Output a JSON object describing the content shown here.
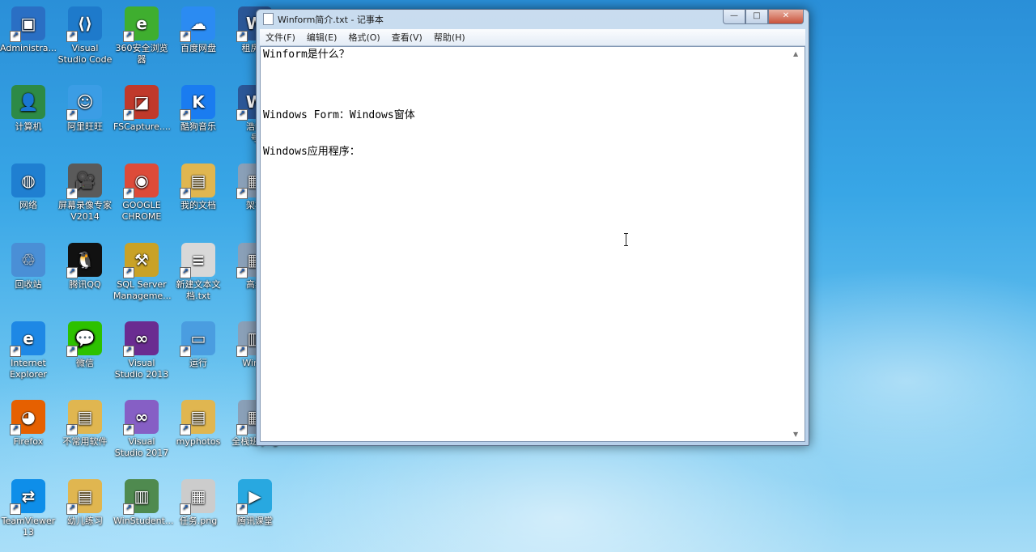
{
  "desktop_icons": [
    {
      "label": "Administra...",
      "glyph": "▣",
      "color": "#2a6fc4"
    },
    {
      "label": "Visual Studio Code",
      "glyph": "⟨⟩",
      "color": "#1e7acb"
    },
    {
      "label": "360安全浏览器",
      "glyph": "e",
      "color": "#3fae2f"
    },
    {
      "label": "百度网盘",
      "glyph": "☁",
      "color": "#2b8bf2"
    },
    {
      "label": "租房合",
      "glyph": "W",
      "color": "#2b5797"
    },
    {
      "label": "计算机",
      "glyph": "👤",
      "color": "#2d8a46"
    },
    {
      "label": "阿里旺旺",
      "glyph": "☺",
      "color": "#3b9de5"
    },
    {
      "label": "FSCapture....",
      "glyph": "◪",
      "color": "#c0392b"
    },
    {
      "label": "酷狗音乐",
      "glyph": "K",
      "color": "#1a7cf0"
    },
    {
      "label": "浩峰",
      "glyph": "W",
      "color": "#2b5797"
    },
    {
      "label": "号",
      "glyph": "",
      "color": "transparent"
    },
    {
      "label": "网络",
      "glyph": "◍",
      "color": "#1f7fd1"
    },
    {
      "label": "屏幕录像专家V2014",
      "glyph": "🎥",
      "color": "#5a5a5a"
    },
    {
      "label": "GOOGLE CHROME",
      "glyph": "◉",
      "color": "#dd4b39"
    },
    {
      "label": "我的文档",
      "glyph": "▤",
      "color": "#e0b650"
    },
    {
      "label": "架构",
      "glyph": "▦",
      "color": "#8aa0b8"
    },
    {
      "label": "回收站",
      "glyph": "♲",
      "color": "#4a8fd6"
    },
    {
      "label": "腾讯QQ",
      "glyph": "🐧",
      "color": "#111"
    },
    {
      "label": "SQL Server Manageme...",
      "glyph": "⚒",
      "color": "#c9a227"
    },
    {
      "label": "新建文本文档.txt",
      "glyph": "≡",
      "color": "#d8d8d8"
    },
    {
      "label": "高级",
      "glyph": "▦",
      "color": "#8aa0b8"
    },
    {
      "label": "Internet Explorer",
      "glyph": "e",
      "color": "#1e88e5"
    },
    {
      "label": "微信",
      "glyph": "💬",
      "color": "#2dc100"
    },
    {
      "label": "Visual Studio 2013",
      "glyph": "∞",
      "color": "#6a2c91"
    },
    {
      "label": "运行",
      "glyph": "▭",
      "color": "#4a9de0"
    },
    {
      "label": "Winfo",
      "glyph": "▥",
      "color": "#8aa0b8"
    },
    {
      "label": "Firefox",
      "glyph": "◕",
      "color": "#e66000"
    },
    {
      "label": "不常用软件",
      "glyph": "▤",
      "color": "#e0b650"
    },
    {
      "label": "Visual Studio 2017",
      "glyph": "∞",
      "color": "#865fc5"
    },
    {
      "label": "myphotos",
      "glyph": "▤",
      "color": "#e0b650"
    },
    {
      "label": "全栈班.png",
      "glyph": "▦",
      "color": "#8aa0b8"
    },
    {
      "label": "TeamViewer 13",
      "glyph": "⇄",
      "color": "#0e8ee9"
    },
    {
      "label": "幼儿练习",
      "glyph": "▤",
      "color": "#e0b650"
    },
    {
      "label": "WinStudent...",
      "glyph": "▥",
      "color": "#4f8a4f"
    },
    {
      "label": "任务.png",
      "glyph": "▦",
      "color": "#cccccc"
    },
    {
      "label": "腾讯课堂",
      "glyph": "▶",
      "color": "#28a8e0"
    }
  ],
  "window": {
    "title": "Winform简介.txt - 记事本",
    "controls": {
      "minimize": "—",
      "maximize": "□",
      "close": "✕"
    },
    "menu": [
      "文件(F)",
      "编辑(E)",
      "格式(O)",
      "查看(V)",
      "帮助(H)"
    ],
    "lines": [
      "Winform是什么？",
      "",
      "",
      "",
      "",
      "Windows Form：Windows窗体",
      "",
      "",
      "Windows应用程序："
    ],
    "scroll_up": "▲",
    "scroll_down": "▼"
  }
}
